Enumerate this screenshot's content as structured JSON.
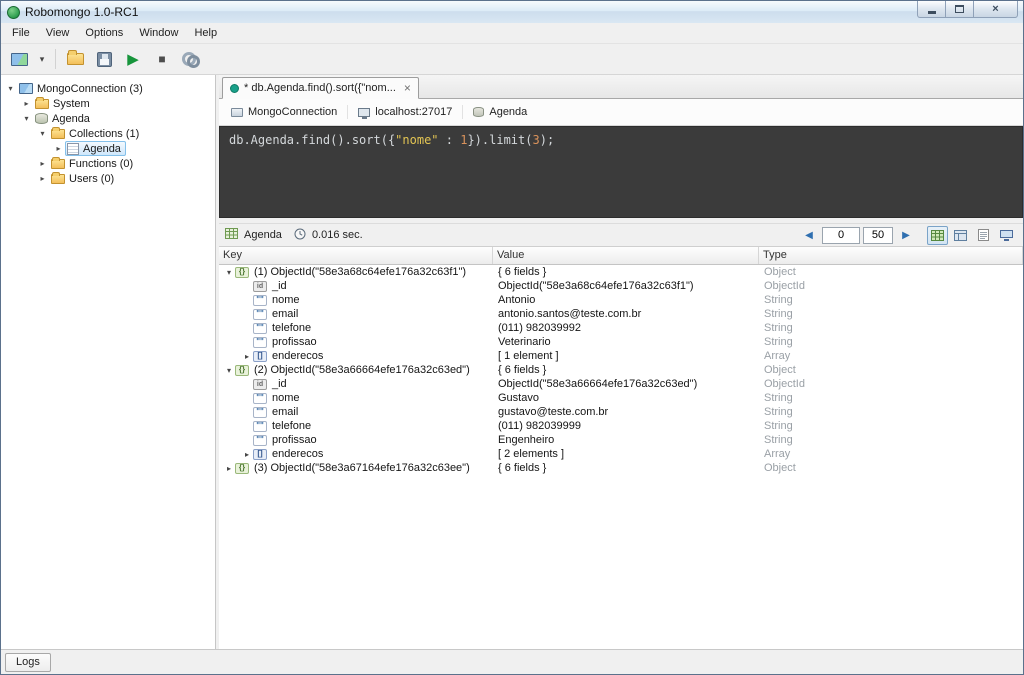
{
  "colors": {
    "selection_highlight": "#cfe7fb",
    "editor_background": "#3b3b3b",
    "editor_string": "#e3c553",
    "editor_number": "#d9925b",
    "type_column_text": "#9aa0a6",
    "execute_green": "#17953c",
    "tab_dot_teal": "#19a089"
  },
  "icons": {
    "connections_dropdown": "▾",
    "execute": "▶",
    "stop": "■",
    "prev_page": "◀",
    "next_page": "▶",
    "tab_close": "×",
    "window_close": "×"
  },
  "window": {
    "title": "Robomongo 1.0-RC1"
  },
  "menu": {
    "items": [
      "File",
      "View",
      "Options",
      "Window",
      "Help"
    ]
  },
  "sidebar": {
    "items": [
      {
        "label": "MongoConnection (3)",
        "level": 0,
        "expander": "▾",
        "icon": "connection",
        "selected": false
      },
      {
        "label": "System",
        "level": 1,
        "expander": "▸",
        "icon": "folder",
        "selected": false
      },
      {
        "label": "Agenda",
        "level": 1,
        "expander": "▾",
        "icon": "database",
        "selected": false
      },
      {
        "label": "Collections (1)",
        "level": 2,
        "expander": "▾",
        "icon": "folder",
        "selected": false
      },
      {
        "label": "Agenda",
        "level": 3,
        "expander": "▸",
        "icon": "collection",
        "selected": true
      },
      {
        "label": "Functions (0)",
        "level": 2,
        "expander": "▸",
        "icon": "folder",
        "selected": false
      },
      {
        "label": "Users (0)",
        "level": 2,
        "expander": "▸",
        "icon": "folder",
        "selected": false
      }
    ]
  },
  "tabs": {
    "active": {
      "title": "* db.Agenda.find().sort({\"nom...",
      "close_glyph": "×"
    }
  },
  "breadcrumb": {
    "connection": "MongoConnection",
    "server": "localhost:27017",
    "database": "Agenda"
  },
  "editor": {
    "code": [
      {
        "t": "db.Agenda.find().sort({"
      },
      {
        "t": "\"nome\""
      },
      {
        "t": " : "
      },
      {
        "t": "1"
      },
      {
        "t": "}).limit("
      },
      {
        "t": "3"
      },
      {
        "t": ");"
      }
    ]
  },
  "results": {
    "collection": "Agenda",
    "time": "0.016 sec.",
    "nav": {
      "prev": "◀",
      "next": "▶",
      "skip": "0",
      "batch": "50"
    },
    "columns": [
      "Key",
      "Value",
      "Type"
    ],
    "rows": [
      {
        "level": 0,
        "expander": "▾",
        "icon": "object",
        "key": "(1) ObjectId(\"58e3a68c64efe176a32c63f1\")",
        "value": "{ 6 fields }",
        "type": "Object"
      },
      {
        "level": 1,
        "expander": "",
        "icon": "id",
        "key": "_id",
        "value": "ObjectId(\"58e3a68c64efe176a32c63f1\")",
        "type": "ObjectId"
      },
      {
        "level": 1,
        "expander": "",
        "icon": "string",
        "key": "nome",
        "value": "Antonio",
        "type": "String"
      },
      {
        "level": 1,
        "expander": "",
        "icon": "string",
        "key": "email",
        "value": "antonio.santos@teste.com.br",
        "type": "String"
      },
      {
        "level": 1,
        "expander": "",
        "icon": "string",
        "key": "telefone",
        "value": "(011) 982039992",
        "type": "String"
      },
      {
        "level": 1,
        "expander": "",
        "icon": "string",
        "key": "profissao",
        "value": "Veterinario",
        "type": "String"
      },
      {
        "level": 1,
        "expander": "▸",
        "icon": "array",
        "key": "enderecos",
        "value": "[ 1 element ]",
        "type": "Array"
      },
      {
        "level": 0,
        "expander": "▾",
        "icon": "object",
        "key": "(2) ObjectId(\"58e3a66664efe176a32c63ed\")",
        "value": "{ 6 fields }",
        "type": "Object"
      },
      {
        "level": 1,
        "expander": "",
        "icon": "id",
        "key": "_id",
        "value": "ObjectId(\"58e3a66664efe176a32c63ed\")",
        "type": "ObjectId"
      },
      {
        "level": 1,
        "expander": "",
        "icon": "string",
        "key": "nome",
        "value": "Gustavo",
        "type": "String"
      },
      {
        "level": 1,
        "expander": "",
        "icon": "string",
        "key": "email",
        "value": "gustavo@teste.com.br",
        "type": "String"
      },
      {
        "level": 1,
        "expander": "",
        "icon": "string",
        "key": "telefone",
        "value": "(011) 982039999",
        "type": "String"
      },
      {
        "level": 1,
        "expander": "",
        "icon": "string",
        "key": "profissao",
        "value": "Engenheiro",
        "type": "String"
      },
      {
        "level": 1,
        "expander": "▸",
        "icon": "array",
        "key": "enderecos",
        "value": "[ 2 elements ]",
        "type": "Array"
      },
      {
        "level": 0,
        "expander": "▸",
        "icon": "object",
        "key": "(3) ObjectId(\"58e3a67164efe176a32c63ee\")",
        "value": "{ 6 fields }",
        "type": "Object"
      }
    ]
  },
  "statusbar": {
    "logs": "Logs"
  }
}
